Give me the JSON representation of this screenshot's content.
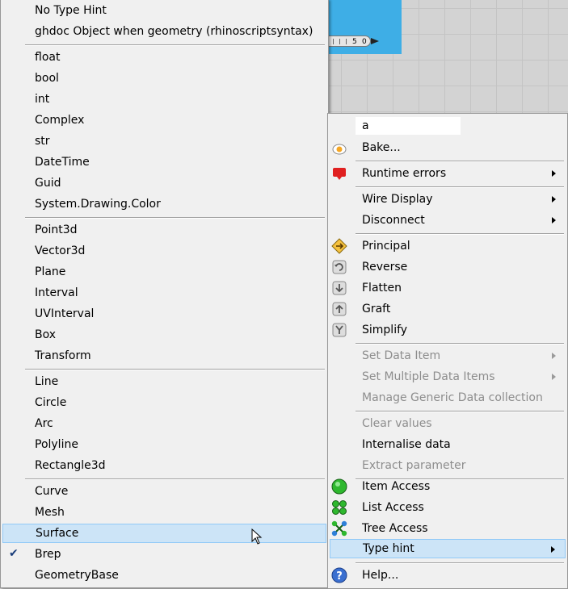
{
  "canvas": {
    "slider_values": [
      "5",
      "0"
    ]
  },
  "type_menu": {
    "items": [
      {
        "label": "No Type Hint"
      },
      {
        "label": "ghdoc Object when geometry (rhinoscriptsyntax)"
      },
      {
        "label": "float"
      },
      {
        "label": "bool"
      },
      {
        "label": "int"
      },
      {
        "label": "Complex"
      },
      {
        "label": "str"
      },
      {
        "label": "DateTime"
      },
      {
        "label": "Guid"
      },
      {
        "label": "System.Drawing.Color"
      },
      {
        "label": "Point3d"
      },
      {
        "label": "Vector3d"
      },
      {
        "label": "Plane"
      },
      {
        "label": "Interval"
      },
      {
        "label": "UVInterval"
      },
      {
        "label": "Box"
      },
      {
        "label": "Transform"
      },
      {
        "label": "Line"
      },
      {
        "label": "Circle"
      },
      {
        "label": "Arc"
      },
      {
        "label": "Polyline"
      },
      {
        "label": "Rectangle3d"
      },
      {
        "label": "Curve"
      },
      {
        "label": "Mesh"
      },
      {
        "label": "Surface",
        "state": "hover"
      },
      {
        "label": "Brep",
        "state": "checked"
      },
      {
        "label": "GeometryBase"
      }
    ]
  },
  "context_menu": {
    "name_value": "a",
    "items": [
      {
        "label": "Bake...",
        "icon": "bake-icon"
      },
      {
        "label": "Runtime errors",
        "icon": "runtime-errors-icon",
        "submenu": true
      },
      {
        "label": "Wire Display",
        "submenu": true
      },
      {
        "label": "Disconnect",
        "submenu": true
      },
      {
        "label": "Principal",
        "icon": "principal-icon"
      },
      {
        "label": "Reverse",
        "icon": "reverse-icon"
      },
      {
        "label": "Flatten",
        "icon": "flatten-icon"
      },
      {
        "label": "Graft",
        "icon": "graft-icon"
      },
      {
        "label": "Simplify",
        "icon": "simplify-icon"
      },
      {
        "label": "Set Data Item",
        "disabled": true,
        "submenu": true
      },
      {
        "label": "Set Multiple Data Items",
        "disabled": true,
        "submenu": true
      },
      {
        "label": "Manage Generic Data collection",
        "disabled": true
      },
      {
        "label": "Clear values",
        "disabled": true
      },
      {
        "label": "Internalise data"
      },
      {
        "label": "Extract parameter",
        "disabled": true
      },
      {
        "label": "Item Access",
        "icon": "item-access-icon"
      },
      {
        "label": "List Access",
        "icon": "list-access-icon"
      },
      {
        "label": "Tree Access",
        "icon": "tree-access-icon"
      },
      {
        "label": "Type hint",
        "submenu": true,
        "state": "highlight"
      },
      {
        "label": "Help...",
        "icon": "help-icon"
      }
    ]
  },
  "colors": {
    "component": "#3eaee6",
    "highlight": "#cce4f7",
    "disabled_text": "#8d8d8d"
  }
}
